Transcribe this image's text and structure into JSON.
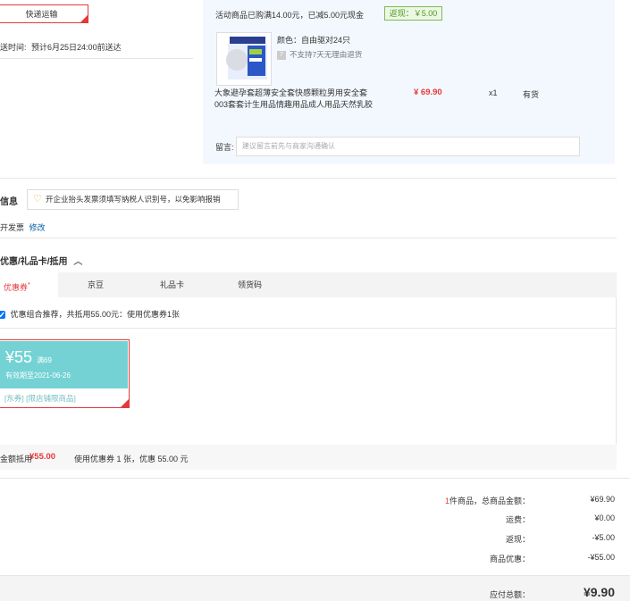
{
  "shipping": {
    "method_label": "快递运输",
    "time_label": "送时间:",
    "time_value": "预计6月25日24:00前送达"
  },
  "promo": {
    "text": "活动商品已购满14.00元，已减5.00元现金",
    "rebate_badge": "返现：￥5.00"
  },
  "product": {
    "color_label": "颜色：",
    "color_value": "自由驱对24只",
    "return_policy": "不支持7天无理由退货",
    "title_line1": "大象避孕套超薄安全套快感颗粒男用安全套",
    "title_line2": "003套套计生用品情趣用品成人用品天然乳胶",
    "price": "¥ 69.90",
    "quantity": "x1",
    "stock": "有货"
  },
  "remark": {
    "label": "留言:",
    "placeholder": "建议留言前先与商家沟通确认"
  },
  "invoice": {
    "section_title": "信息",
    "tip": "开企业抬头发票须填写纳税人识别号，以免影响报销",
    "status": "开发票",
    "edit_link": "修改"
  },
  "discount": {
    "section_title": "优惠/礼品卡/抵用",
    "tabs": [
      "优惠券",
      "京豆",
      "礼品卡",
      "领货码"
    ],
    "recommend_text": "优惠组合推荐，共抵用55.00元：使用优惠券1张",
    "coupon": {
      "amount": "¥55",
      "condition": "满69",
      "validity": "有效期至2021-06-26",
      "tags": "[东券] [限店铺限商品]"
    },
    "summary_label": "金额抵用",
    "summary_amount": "¥55.00",
    "summary_detail": "使用优惠券 1 张，优惠 55.00 元"
  },
  "totals": {
    "count": "1",
    "count_suffix": "件商品，总商品金额：",
    "goods_amount": "¥69.90",
    "freight_label": "运费：",
    "freight": "¥0.00",
    "rebate_label": "返现：",
    "rebate": "-¥5.00",
    "discount_label": "商品优惠：",
    "discount": "-¥55.00",
    "payable_label": "应付总额：",
    "payable": "¥9.90"
  },
  "colors": {
    "accent_red": "#e4393c",
    "rebate_green": "#4b9b1a",
    "coupon_teal": "#74d2d4",
    "panel_blue": "#f3f8fe"
  }
}
